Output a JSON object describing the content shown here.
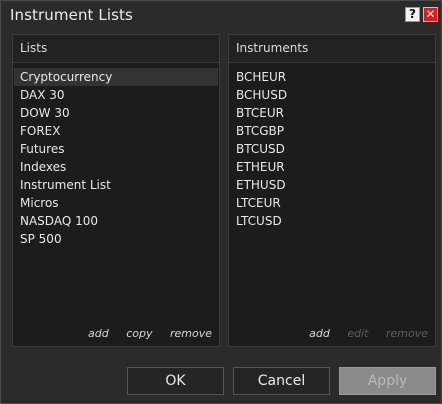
{
  "window": {
    "title": "Instrument Lists",
    "help_label": "?",
    "close_label": "✕"
  },
  "lists_panel": {
    "header": "Lists",
    "items": [
      {
        "label": "Cryptocurrency",
        "selected": true
      },
      {
        "label": "DAX 30"
      },
      {
        "label": "DOW 30"
      },
      {
        "label": "FOREX"
      },
      {
        "label": "Futures"
      },
      {
        "label": "Indexes"
      },
      {
        "label": "Instrument List"
      },
      {
        "label": "Micros"
      },
      {
        "label": "NASDAQ 100"
      },
      {
        "label": "SP 500"
      }
    ],
    "actions": {
      "add": "add",
      "copy": "copy",
      "remove": "remove"
    }
  },
  "instruments_panel": {
    "header": "Instruments",
    "items": [
      {
        "label": "BCHEUR"
      },
      {
        "label": "BCHUSD"
      },
      {
        "label": "BTCEUR"
      },
      {
        "label": "BTCGBP"
      },
      {
        "label": "BTCUSD"
      },
      {
        "label": "ETHEUR"
      },
      {
        "label": "ETHUSD"
      },
      {
        "label": "LTCEUR"
      },
      {
        "label": "LTCUSD"
      }
    ],
    "actions": {
      "add": "add",
      "edit": "edit",
      "remove": "remove"
    }
  },
  "buttons": {
    "ok": "OK",
    "cancel": "Cancel",
    "apply": "Apply"
  },
  "colors": {
    "window_bg": "#2b2b2b",
    "panel_bg": "#1c1c1c",
    "close_red": "#d71f1f",
    "apply_disabled": "#8a8a8a"
  }
}
